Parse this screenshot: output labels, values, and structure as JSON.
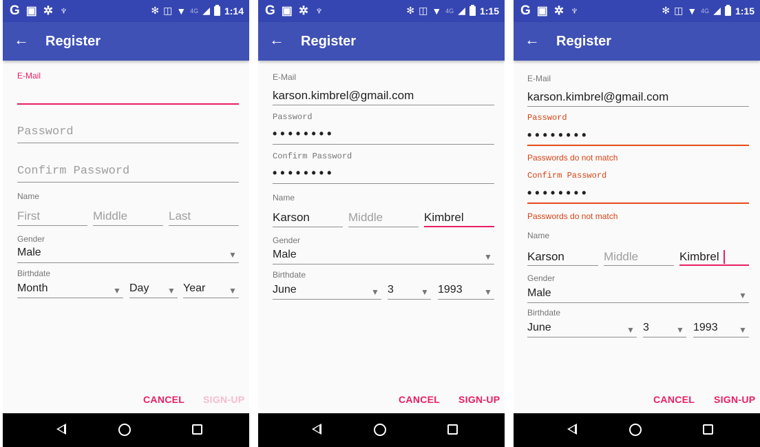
{
  "colors": {
    "status_bar": "#3546b2",
    "app_bar": "#3f51b5",
    "accent": "#e91e63",
    "error": "#d84315"
  },
  "screens": [
    {
      "status": {
        "time": "1:14"
      },
      "app_bar": {
        "title": "Register",
        "back_icon": "←"
      },
      "email": {
        "label": "E-Mail",
        "value": ""
      },
      "password": {
        "placeholder": "Password"
      },
      "confirm_password": {
        "placeholder": "Confirm Password"
      },
      "name": {
        "label": "Name",
        "first": "First",
        "middle": "Middle",
        "last": "Last"
      },
      "gender": {
        "label": "Gender",
        "value": "Male"
      },
      "birthdate": {
        "label": "Birthdate",
        "month": "Month",
        "day": "Day",
        "year": "Year"
      },
      "buttons": {
        "cancel": "CANCEL",
        "signup": "SIGN-UP"
      }
    },
    {
      "status": {
        "time": "1:15"
      },
      "app_bar": {
        "title": "Register",
        "back_icon": "←"
      },
      "email": {
        "label": "E-Mail",
        "value": "karson.kimbrel@gmail.com"
      },
      "password": {
        "label": "Password",
        "value": "••••••••"
      },
      "confirm_password": {
        "label": "Confirm Password",
        "value": "••••••••"
      },
      "name": {
        "label": "Name",
        "first": "Karson",
        "middle": "Middle",
        "last": "Kimbrel"
      },
      "gender": {
        "label": "Gender",
        "value": "Male"
      },
      "birthdate": {
        "label": "Birthdate",
        "month": "June",
        "day": "3",
        "year": "1993"
      },
      "buttons": {
        "cancel": "CANCEL",
        "signup": "SIGN-UP"
      }
    },
    {
      "status": {
        "time": "1:15"
      },
      "app_bar": {
        "title": "Register",
        "back_icon": "←"
      },
      "email": {
        "label": "E-Mail",
        "value": "karson.kimbrel@gmail.com"
      },
      "password": {
        "label": "Password",
        "value": "••••••••",
        "error": "Passwords do not match"
      },
      "confirm_password": {
        "label": "Confirm Password",
        "value": "••••••••",
        "error": "Passwords do not match"
      },
      "name": {
        "label": "Name",
        "first": "Karson",
        "middle": "Middle",
        "last": "Kimbrel"
      },
      "gender": {
        "label": "Gender",
        "value": "Male"
      },
      "birthdate": {
        "label": "Birthdate",
        "month": "June",
        "day": "3",
        "year": "1993"
      },
      "buttons": {
        "cancel": "CANCEL",
        "signup": "SIGN-UP"
      }
    }
  ]
}
